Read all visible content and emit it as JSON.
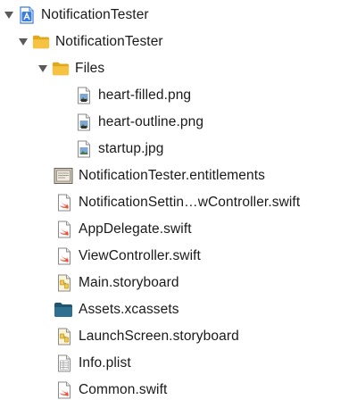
{
  "navigator": {
    "items": [
      {
        "label": "NotificationTester",
        "icon": "xcode-project-icon",
        "disclosure": "expanded"
      },
      {
        "label": "NotificationTester",
        "icon": "folder-icon",
        "disclosure": "expanded"
      },
      {
        "label": "Files",
        "icon": "folder-icon",
        "disclosure": "expanded"
      },
      {
        "label": "heart-filled.png",
        "icon": "image-file-icon",
        "disclosure": "none"
      },
      {
        "label": "heart-outline.png",
        "icon": "image-file-icon",
        "disclosure": "none"
      },
      {
        "label": "startup.jpg",
        "icon": "image-file-icon",
        "disclosure": "none"
      },
      {
        "label": "NotificationTester.entitlements",
        "icon": "entitlements-file-icon",
        "disclosure": "none"
      },
      {
        "label": "NotificationSettin…wController.swift",
        "icon": "swift-file-icon",
        "disclosure": "none"
      },
      {
        "label": "AppDelegate.swift",
        "icon": "swift-file-icon",
        "disclosure": "none"
      },
      {
        "label": "ViewController.swift",
        "icon": "swift-file-icon",
        "disclosure": "none"
      },
      {
        "label": "Main.storyboard",
        "icon": "storyboard-file-icon",
        "disclosure": "none"
      },
      {
        "label": "Assets.xcassets",
        "icon": "asset-catalog-icon",
        "disclosure": "none"
      },
      {
        "label": "LaunchScreen.storyboard",
        "icon": "storyboard-file-icon",
        "disclosure": "none"
      },
      {
        "label": "Info.plist",
        "icon": "plist-file-icon",
        "disclosure": "none"
      },
      {
        "label": "Common.swift",
        "icon": "swift-file-icon",
        "disclosure": "none"
      }
    ]
  },
  "colors": {
    "folder": "#f5c242",
    "folder_dark": "#e0a81e",
    "swift": "#f05138",
    "project": "#3b7ddd",
    "asset": "#2f6f8f",
    "disclosure": "#5a5a5a"
  }
}
